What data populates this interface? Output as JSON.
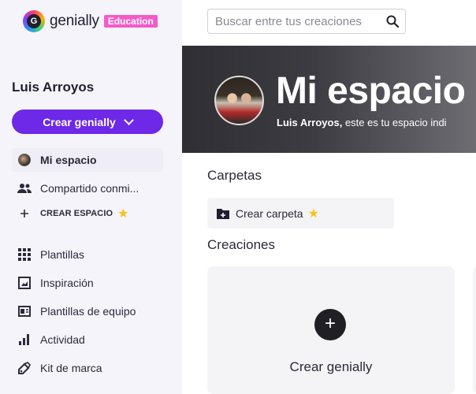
{
  "brand": {
    "name": "genially",
    "badge": "Education"
  },
  "sidebar": {
    "user_name": "Luis Arroyos",
    "create_button": "Crear genially",
    "items": [
      {
        "label": "Mi espacio",
        "icon": "avatar-icon",
        "active": true
      },
      {
        "label": "Compartido conmi...",
        "icon": "people-icon"
      },
      {
        "label": "CREAR ESPACIO",
        "icon": "plus-icon"
      },
      {
        "label": "Plantillas",
        "icon": "grid-icon"
      },
      {
        "label": "Inspiración",
        "icon": "frame-icon"
      },
      {
        "label": "Plantillas de equipo",
        "icon": "template-icon"
      },
      {
        "label": "Actividad",
        "icon": "bar-chart-icon"
      },
      {
        "label": "Kit de marca",
        "icon": "brand-kit-icon"
      }
    ]
  },
  "search": {
    "placeholder": "Buscar entre tus creaciones"
  },
  "banner": {
    "title": "Mi espacio",
    "subtitle_name": "Luis Arroyos,",
    "subtitle_rest": " este es tu espacio indi"
  },
  "folders": {
    "title": "Carpetas",
    "create_label": "Crear carpeta"
  },
  "creations": {
    "title": "Creaciones",
    "create_label": "Crear genially"
  },
  "colors": {
    "accent": "#6d28e8",
    "badge": "#f55bc8",
    "star": "#f6c21b"
  }
}
